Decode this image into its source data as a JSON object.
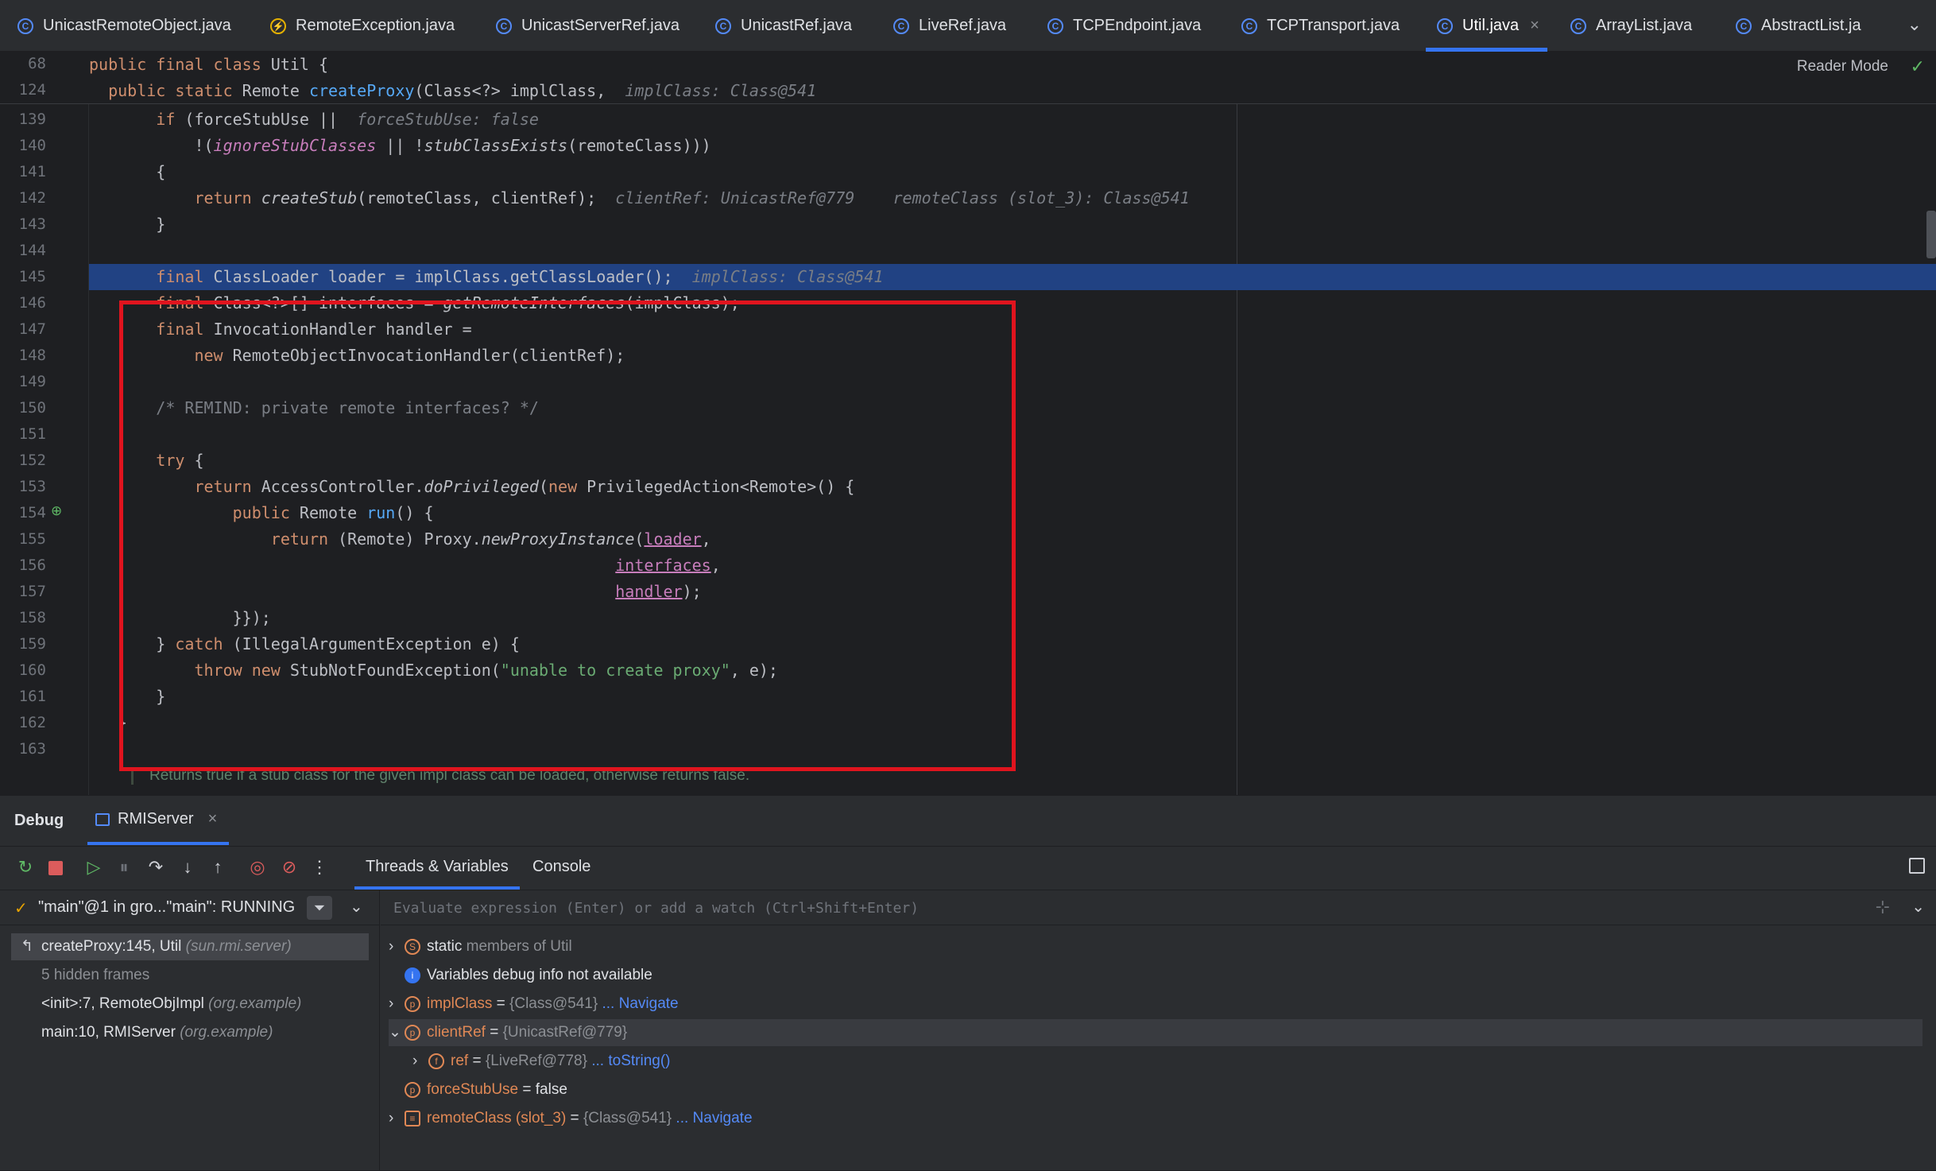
{
  "tabs": [
    {
      "label": "UnicastRemoteObject.java",
      "icon": "class-icon"
    },
    {
      "label": "RemoteException.java",
      "icon": "exception-icon"
    },
    {
      "label": "UnicastServerRef.java",
      "icon": "class-icon"
    },
    {
      "label": "UnicastRef.java",
      "icon": "class-icon"
    },
    {
      "label": "LiveRef.java",
      "icon": "class-icon"
    },
    {
      "label": "TCPEndpoint.java",
      "icon": "class-icon"
    },
    {
      "label": "TCPTransport.java",
      "icon": "class-icon"
    },
    {
      "label": "Util.java",
      "icon": "class-icon",
      "active": true
    },
    {
      "label": "ArrayList.java",
      "icon": "class-icon"
    },
    {
      "label": "AbstractList.ja",
      "icon": "class-icon"
    }
  ],
  "editor": {
    "reader_mode": "Reader Mode",
    "sticky": [
      {
        "num": "68",
        "text": "public final class Util {"
      },
      {
        "num": "124",
        "text": "    public static Remote createProxy(Class<?> implClass,",
        "hint": "implClass: Class@541"
      }
    ],
    "line_numbers": [
      "139",
      "140",
      "141",
      "142",
      "143",
      "144",
      "145",
      "146",
      "147",
      "148",
      "149",
      "150",
      "151",
      "152",
      "153",
      "154",
      "155",
      "156",
      "157",
      "158",
      "159",
      "160",
      "161",
      "162",
      "163"
    ],
    "doc_comment": "Returns true if a stub class for the given impl class can be loaded, otherwise returns false.",
    "hints": {
      "force_stub_use": "forceStubUse: false",
      "client_ref": "clientRef: UnicastRef@779",
      "remote_class": "remoteClass (slot_3): Class@541",
      "impl_class": "implClass: Class@541"
    }
  },
  "debug": {
    "title": "Debug",
    "config": "RMIServer",
    "subtabs": [
      "Threads & Variables",
      "Console"
    ],
    "thread": "\"main\"@1 in gro...\"main\": RUNNING",
    "frames": [
      {
        "method": "createProxy:145, Util",
        "pkg": "(sun.rmi.server)",
        "selected": true
      },
      {
        "method": "5 hidden frames",
        "pkg": "",
        "hidden": true
      },
      {
        "method": "<init>:7, RemoteObjImpl",
        "pkg": "(org.example)"
      },
      {
        "method": "main:10, RMIServer",
        "pkg": "(org.example)"
      }
    ],
    "eval_placeholder": "Evaluate expression (Enter) or add a watch (Ctrl+Shift+Enter)",
    "variables": {
      "static_members": {
        "name": "static",
        "rest": " members of Util"
      },
      "info": "Variables debug info not available",
      "impl_class": {
        "name": "implClass",
        "eq": " = ",
        "value": "{Class@541}",
        "link": "... Navigate"
      },
      "client_ref": {
        "name": "clientRef",
        "eq": " = ",
        "value": "{UnicastRef@779}"
      },
      "ref": {
        "name": "ref",
        "eq": " = ",
        "value": "{LiveRef@778}",
        "link": "... toString()"
      },
      "force_stub_use": {
        "name": "forceStubUse",
        "eq": " = ",
        "value": "false"
      },
      "remote_class": {
        "name": "remoteClass (slot_3)",
        "eq": " = ",
        "value": "{Class@541}",
        "link": "... Navigate"
      }
    }
  }
}
